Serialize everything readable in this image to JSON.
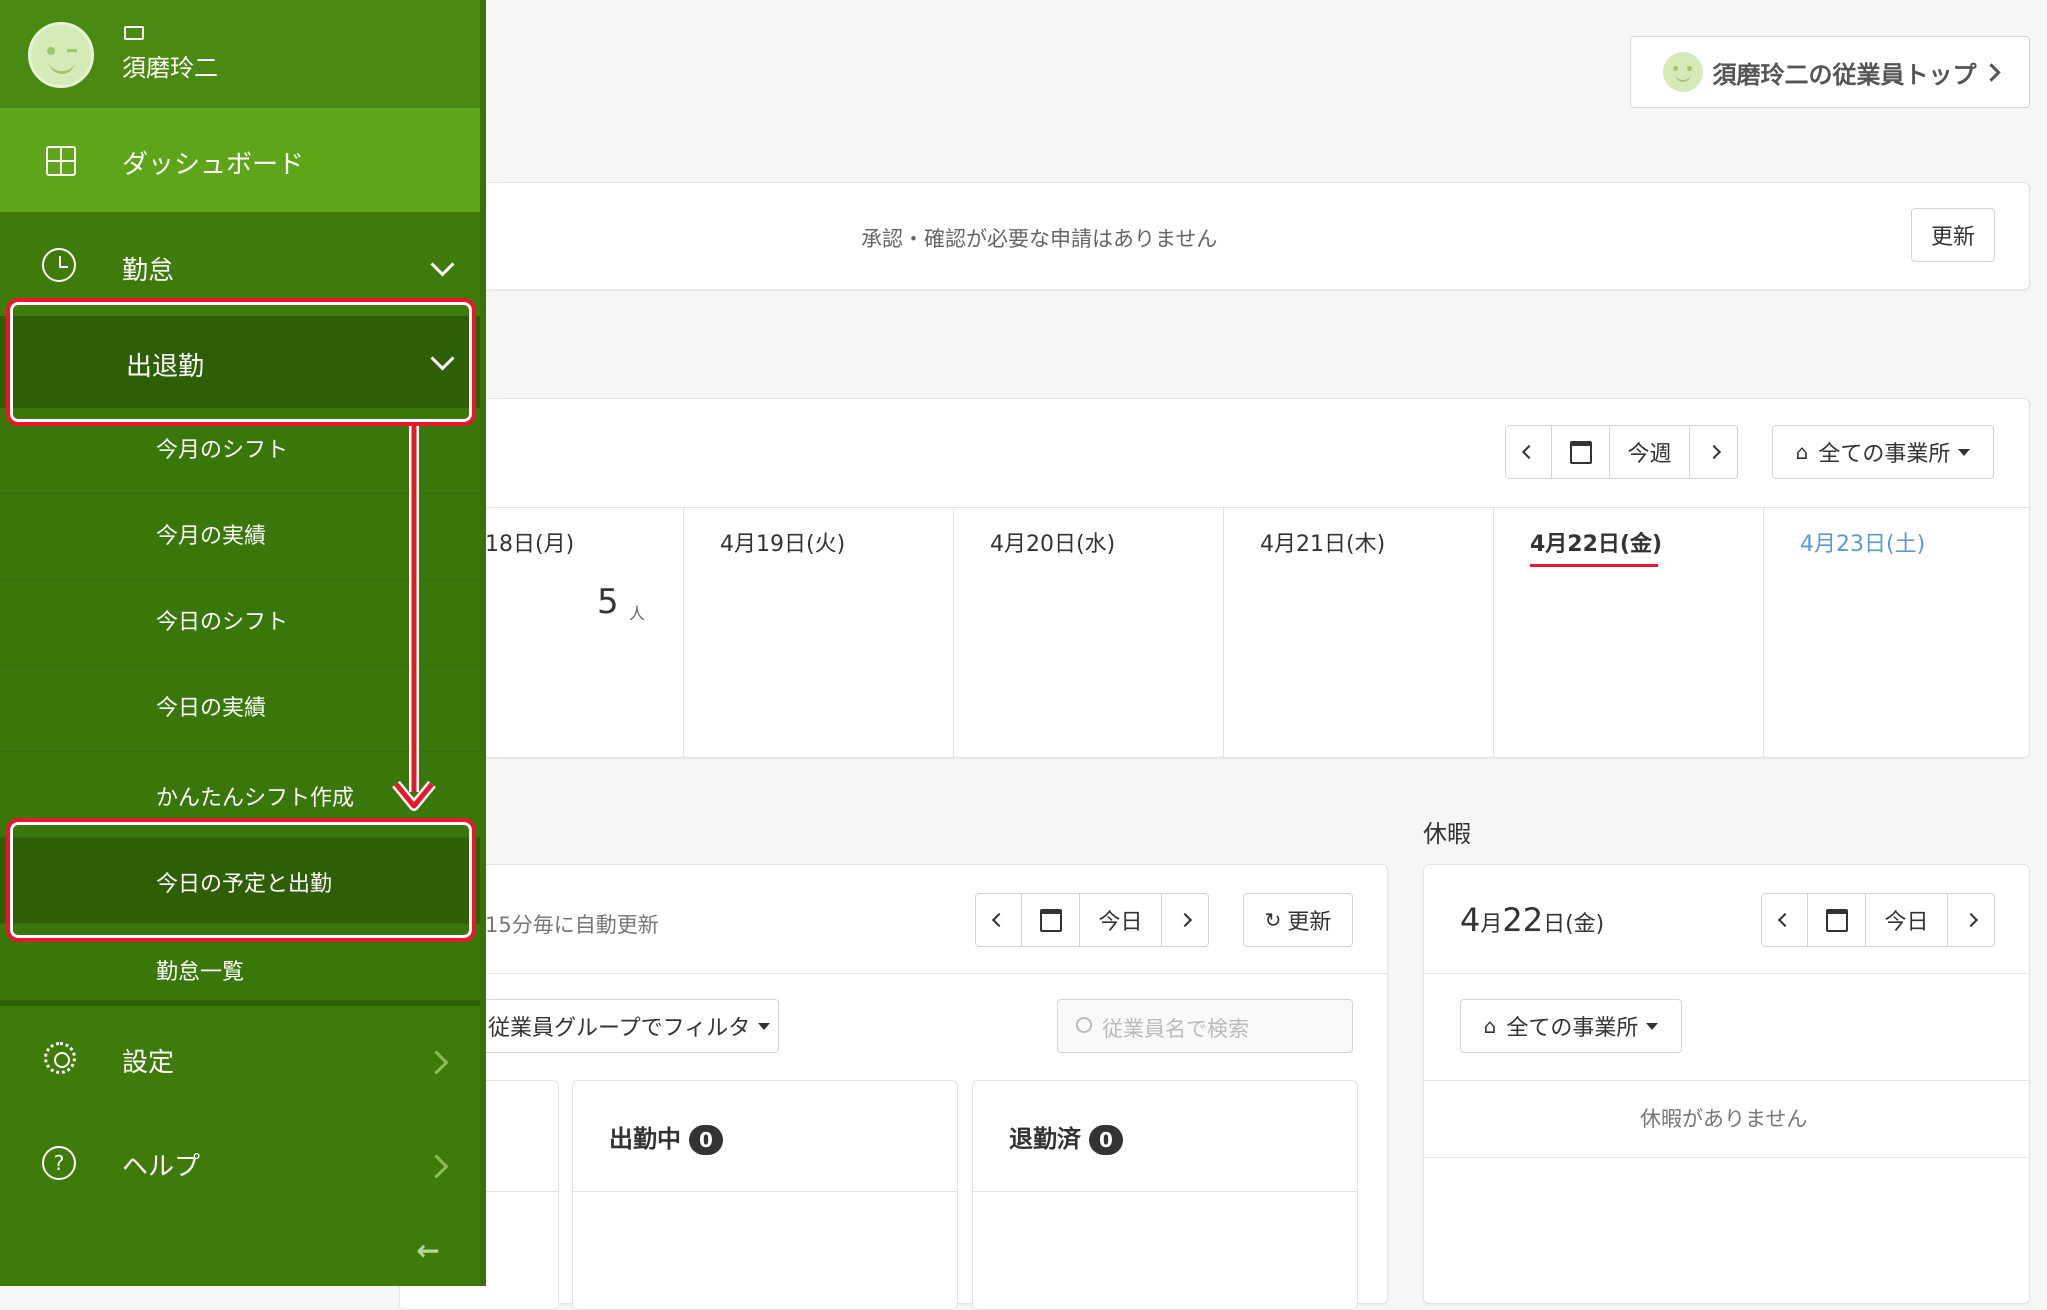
{
  "header": {
    "employee_top_button": "須磨玲二の従業員トップ"
  },
  "approvals": {
    "message": "承認・確認が必要な申請はありません",
    "refresh_label": "更新"
  },
  "week": {
    "today_label": "今週",
    "office_filter": "全ての事業所",
    "days": [
      {
        "label": "18日(月)"
      },
      {
        "label": "4月19日(火)"
      },
      {
        "label": "4月20日(水)"
      },
      {
        "label": "4月21日(木)"
      },
      {
        "label": "4月22日(金)"
      },
      {
        "label": "4月23日(土)"
      }
    ],
    "first_day_partial": "",
    "first_day_count": "5",
    "first_day_unit": "人"
  },
  "attendance": {
    "auto_refresh": "15分毎に自動更新",
    "today_label": "今日",
    "refresh_label": "更新",
    "group_filter": "従業員グループでフィルタ",
    "search_placeholder": "従業員名で検索",
    "working_label": "出勤中",
    "working_count": "0",
    "left_label": "退勤済",
    "left_count": "0"
  },
  "vacation": {
    "section_title": "休暇",
    "date_month": "4",
    "date_month_unit": "月",
    "date_day": "22",
    "date_day_unit": "日(金)",
    "today_label": "今日",
    "office_filter": "全ての事業所",
    "empty_message": "休暇がありません"
  },
  "sidebar": {
    "user_name": "須磨玲二",
    "dashboard": "ダッシュボード",
    "attendance": "勤怠",
    "clock_in_out": "出退勤",
    "sub_items": [
      "今月のシフト",
      "今月の実績",
      "今日のシフト",
      "今日の実績",
      "かんたんシフト作成",
      "今日の予定と出勤",
      "勤怠一覧"
    ],
    "settings": "設定",
    "help": "ヘルプ"
  },
  "colors": {
    "sidebar_bg": "#3f7b0b",
    "sidebar_active": "#5ea51a",
    "sidebar_selected": "#2e5e05",
    "highlight_red": "#e8172b",
    "today_underline": "#e8172b",
    "saturday_blue": "#5b9bd5"
  }
}
